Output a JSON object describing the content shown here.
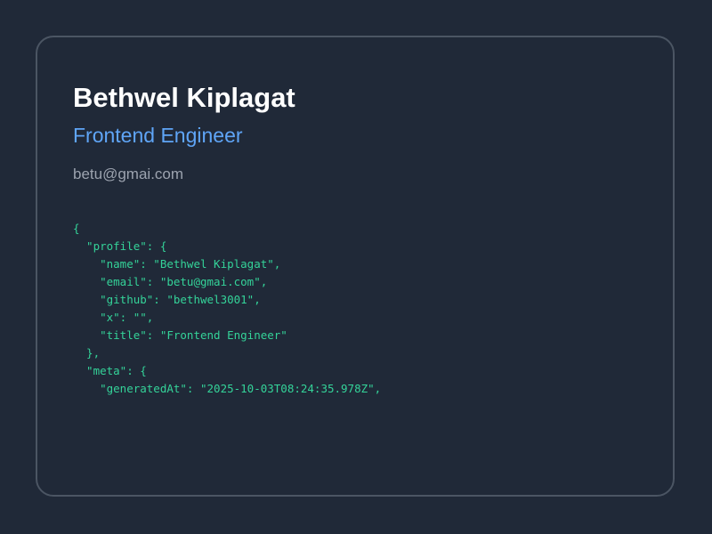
{
  "profile_card": {
    "name": "Bethwel Kiplagat",
    "title": "Frontend Engineer",
    "email": "betu@gmai.com"
  },
  "json_preview": {
    "lines": [
      "{",
      "  \"profile\": {",
      "    \"name\": \"Bethwel Kiplagat\",",
      "    \"email\": \"betu@gmai.com\",",
      "    \"github\": \"bethwel3001\",",
      "    \"x\": \"\",",
      "    \"title\": \"Frontend Engineer\"",
      "  },",
      "  \"meta\": {",
      "    \"generatedAt\": \"2025-10-03T08:24:35.978Z\","
    ]
  },
  "colors": {
    "background": "#202938",
    "card_border": "#4b5563",
    "name": "#ffffff",
    "title": "#5fa5f7",
    "email": "#9ca3af",
    "code": "#34d399"
  }
}
